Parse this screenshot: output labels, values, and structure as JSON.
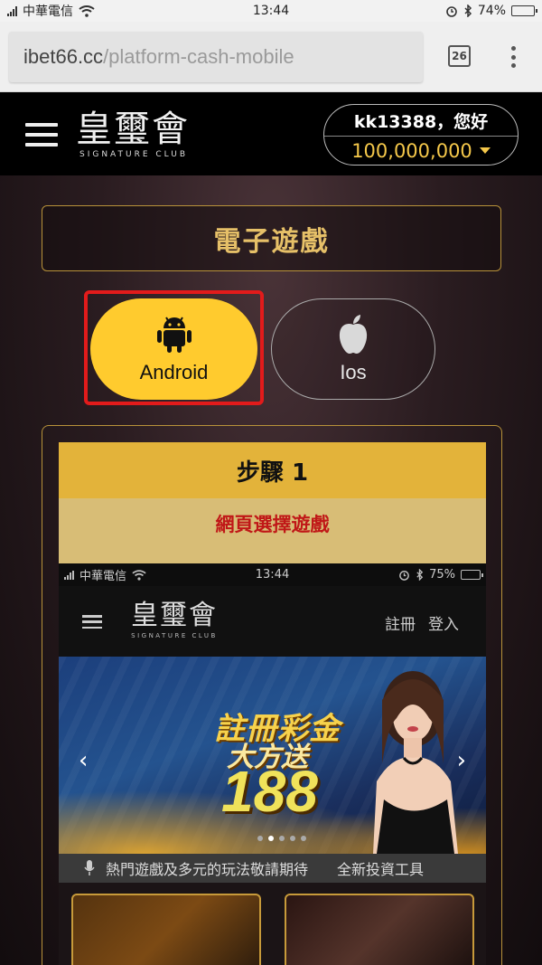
{
  "status_bar": {
    "carrier": "中華電信",
    "time": "13:44",
    "battery": "74%",
    "battery_level": 0.74
  },
  "browser": {
    "url_host": "ibet66.cc",
    "url_path": "/platform-cash-mobile",
    "tab_count": "26"
  },
  "header": {
    "logo_title": "皇璽會",
    "logo_subtitle": "SIGNATURE CLUB",
    "greeting": "kk13388，您好",
    "balance": "100,000,000"
  },
  "page": {
    "section_title": "電子遊戲",
    "platforms": [
      {
        "label": "Android",
        "icon": "android-icon",
        "selected": true
      },
      {
        "label": "Ios",
        "icon": "apple-icon",
        "selected": false
      }
    ]
  },
  "step": {
    "title": "步驟 1",
    "instruction": "網頁選擇遊戲"
  },
  "inner_screenshot": {
    "status": {
      "carrier": "中華電信",
      "time": "13:44",
      "battery": "75%",
      "battery_level": 0.75
    },
    "logo_title": "皇璽會",
    "logo_subtitle": "SIGNATURE CLUB",
    "register_link": "註冊",
    "login_link": "登入",
    "banner": {
      "line1": "註冊彩金",
      "line2": "大方送",
      "number": "188"
    },
    "marquee": "熱門遊戲及多元的玩法敬請期待　　全新投資工具"
  },
  "colors": {
    "accent_gold": "#e3b33a",
    "android_yellow": "#ffcb2e",
    "highlight_red": "#e21b1b",
    "instruction_red": "#c01717"
  }
}
